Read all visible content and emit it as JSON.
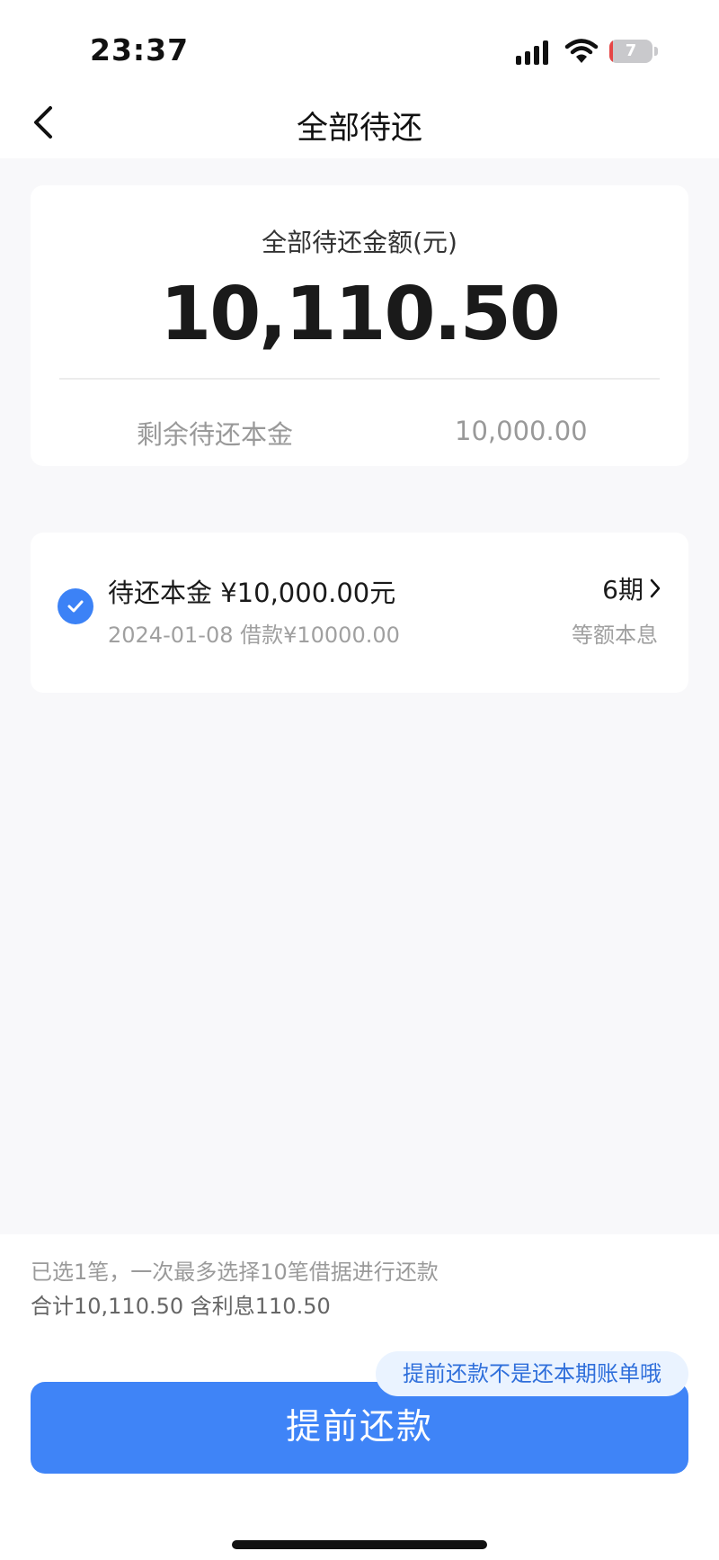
{
  "status_bar": {
    "time": "23:37",
    "battery_level": "7",
    "battery_fraction": 0.07,
    "icons": [
      "signal-icon",
      "wifi-icon",
      "battery-icon"
    ]
  },
  "nav": {
    "title": "全部待还",
    "back_icon": "chevron-left-icon"
  },
  "summary": {
    "label": "全部待还金额(元)",
    "amount": "10,110.50",
    "remaining_label": "剩余待还本金",
    "remaining_value": "10,000.00"
  },
  "loan": {
    "selected": true,
    "title": "待还本金 ¥10,000.00元",
    "subtitle": "2024-01-08 借款¥10000.00",
    "periods": "6期",
    "method": "等额本息"
  },
  "bottom": {
    "selected_note": "已选1笔，一次最多选择10笔借据进行还款",
    "total_note": "合计10,110.50 含利息110.50",
    "tooltip": "提前还款不是还本期账单哦",
    "button_label": "提前还款"
  },
  "colors": {
    "accent": "#3f84f7",
    "tooltip_bg": "#eaf3ff",
    "battery_low": "#e64646"
  }
}
